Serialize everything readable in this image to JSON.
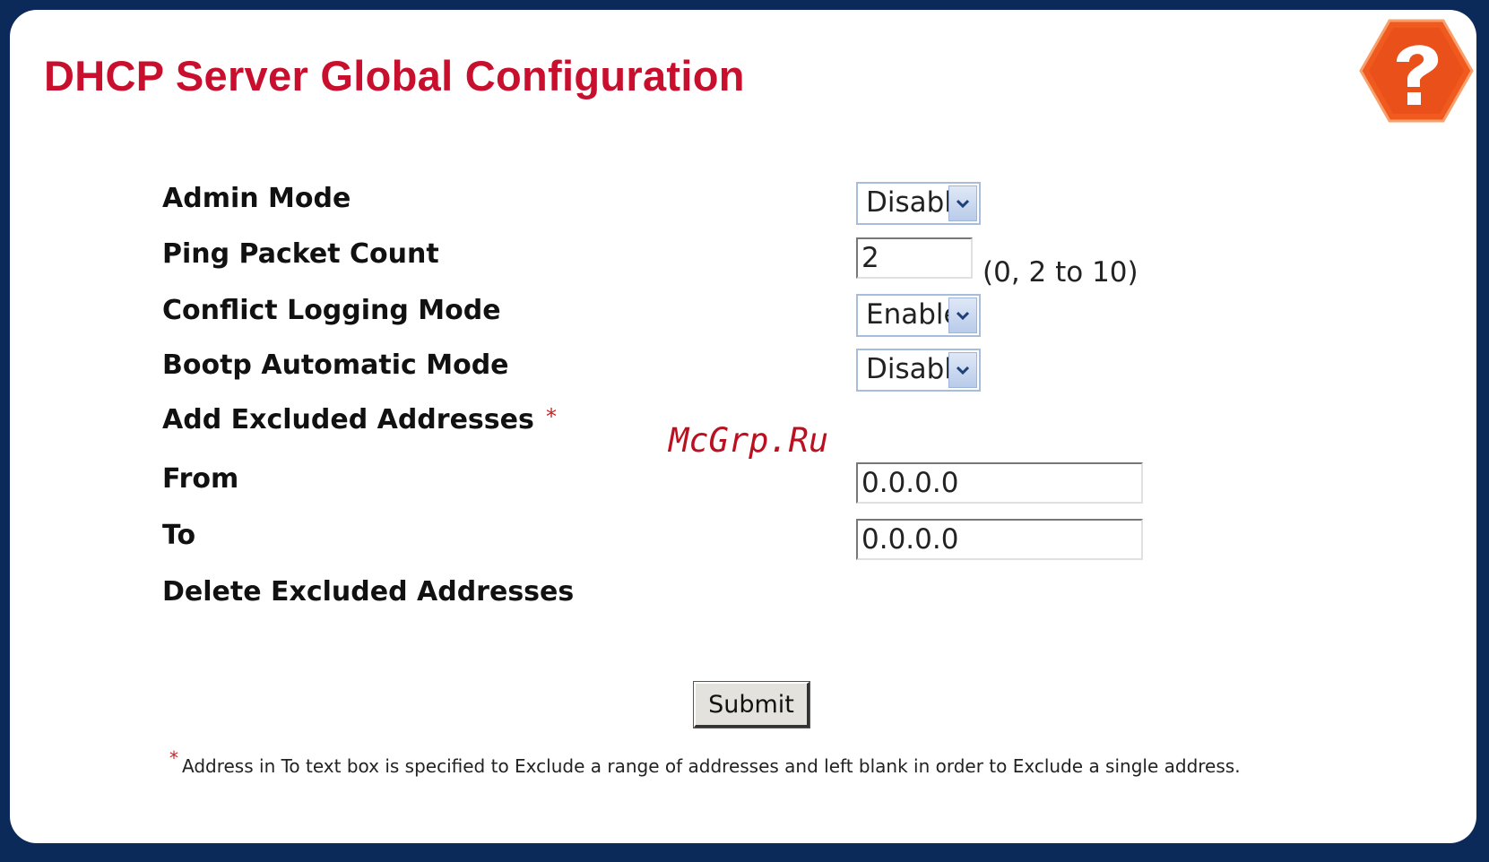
{
  "page": {
    "title": "DHCP Server Global Configuration",
    "help_icon": "question-mark-hexagon-icon",
    "accent_color": "#c8102e",
    "background_color": "#0b2a5a",
    "help_icon_color": "#f05a1e"
  },
  "form": {
    "admin_mode": {
      "label": "Admin Mode",
      "value": "Disable"
    },
    "ping_packet_count": {
      "label": "Ping Packet Count",
      "value": "2",
      "range_hint": "(0, 2 to 10)"
    },
    "conflict_logging_mode": {
      "label": "Conflict Logging Mode",
      "value": "Enable"
    },
    "bootp_automatic_mode": {
      "label": "Bootp Automatic Mode",
      "value": "Disable"
    },
    "add_excluded_addresses": {
      "label": "Add Excluded Addresses",
      "asterisk": "*"
    },
    "from": {
      "label": "From",
      "value": "0.0.0.0"
    },
    "to": {
      "label": "To",
      "value": "0.0.0.0"
    },
    "delete_excluded_addresses": {
      "label": "Delete Excluded Addresses"
    },
    "submit_label": "Submit"
  },
  "watermark": "McGrp.Ru",
  "footnote": {
    "asterisk": "*",
    "text": "Address in To text box is specified to Exclude a range of addresses and left blank in order to Exclude a single address."
  }
}
